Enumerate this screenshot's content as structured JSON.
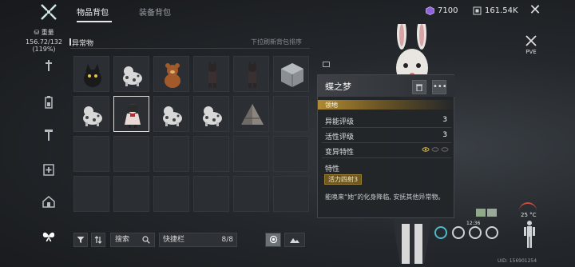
{
  "header": {
    "tabs": [
      "物品背包",
      "装备背包"
    ],
    "currency_primary": "7100",
    "currency_secondary": "161.54K"
  },
  "weight": {
    "label": "重量",
    "value": "156.72/132",
    "percent": "(119%)"
  },
  "inventory": {
    "section_title": "异常物",
    "refresh_hint": "下拉刷新背包排序",
    "items": [
      {
        "icon": "black-cat-figurine"
      },
      {
        "icon": "spotted-cat-figurine"
      },
      {
        "icon": "brown-bear-figurine"
      },
      {
        "icon": "dark-doll-figurine"
      },
      {
        "icon": "dark-doll-figurine"
      },
      {
        "icon": "metal-cube"
      },
      {
        "icon": "spotted-cat-figurine"
      },
      {
        "icon": "girl-doll-figurine",
        "selected": true
      },
      {
        "icon": "spotted-cat-figurine"
      },
      {
        "icon": "spotted-cat-figurine"
      },
      {
        "icon": "stone-pyramid"
      }
    ]
  },
  "toolbar": {
    "search_label": "搜索",
    "hotbar_label": "快捷栏",
    "hotbar_count": "8/8"
  },
  "popup": {
    "title": "蝶之梦",
    "band": "领地",
    "rows": [
      {
        "label": "异能评级",
        "value": "3"
      },
      {
        "label": "活性评级",
        "value": "3"
      },
      {
        "label": "变异特性",
        "value": ""
      }
    ],
    "traits_title": "特性",
    "trait": "活力四射3",
    "description": "能唤来“她”的化身降临, 安抚其他异常物。"
  },
  "hud": {
    "mode": "PVE",
    "temperature": "25 °C",
    "time": "12:36",
    "uid": "UID: 156901254"
  }
}
